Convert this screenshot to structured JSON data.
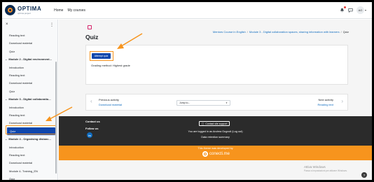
{
  "brand": {
    "name": "OPTIMA",
    "tagline": "optima project"
  },
  "nav": {
    "home": "Home",
    "my_courses": "My courses"
  },
  "user": {
    "initials": "AG"
  },
  "sidebar": {
    "items": [
      {
        "label": "Reading text",
        "type": "item"
      },
      {
        "label": "Download material",
        "type": "item"
      },
      {
        "label": "Quiz",
        "type": "item"
      },
      {
        "label": "Module 2 - Digital environment...",
        "type": "module"
      },
      {
        "label": "Introduction",
        "type": "item"
      },
      {
        "label": "Reading text",
        "type": "item"
      },
      {
        "label": "Download material",
        "type": "item"
      },
      {
        "label": "Quiz",
        "type": "item"
      },
      {
        "label": "Module 3 - Digital collaboratio...",
        "type": "module"
      },
      {
        "label": "Introduction",
        "type": "item"
      },
      {
        "label": "Reading text",
        "type": "item"
      },
      {
        "label": "Download material",
        "type": "item"
      },
      {
        "label": "Quiz",
        "type": "active"
      },
      {
        "label": "Module 4 - Organising distanc...",
        "type": "module"
      },
      {
        "label": "Introduction",
        "type": "item"
      },
      {
        "label": "Reading text",
        "type": "item"
      },
      {
        "label": "Download material",
        "type": "item"
      },
      {
        "label": "Module 4- Training_EN",
        "type": "item"
      },
      {
        "label": "Quiz",
        "type": "item"
      }
    ]
  },
  "page": {
    "title": "Quiz",
    "breadcrumb": [
      "Mentors Course in English",
      "Module 3 - Digital collaboration spaces, sharing information with learners",
      "Quiz"
    ],
    "attempt_label": "Attempt quiz",
    "grading": "Grading method: Highest grade"
  },
  "activity_nav": {
    "prev_label": "Previous activity",
    "prev_link": "Download material",
    "jump_placeholder": "Jump to...",
    "next_label": "Next activity",
    "next_link": "Reading text"
  },
  "footer": {
    "contact_us": "Contact us",
    "follow_us": "Follow us",
    "contact_support": "Contact site support",
    "logged_in": "You are logged in as Andrea Gugnoli (Log out)",
    "data_retention": "Data retention summary",
    "theme_text": "This theme was developed by",
    "developer": "conecti.me"
  },
  "windows": {
    "activate": "Attiva Windows",
    "activate_sub": "Passa a Impostazioni per attivare Windows."
  },
  "help": "?",
  "colors": {
    "accent": "#0f47ad",
    "annotation": "#f7941d",
    "footer_dark": "#2b2b2b",
    "footer_orange": "#f7941d"
  }
}
